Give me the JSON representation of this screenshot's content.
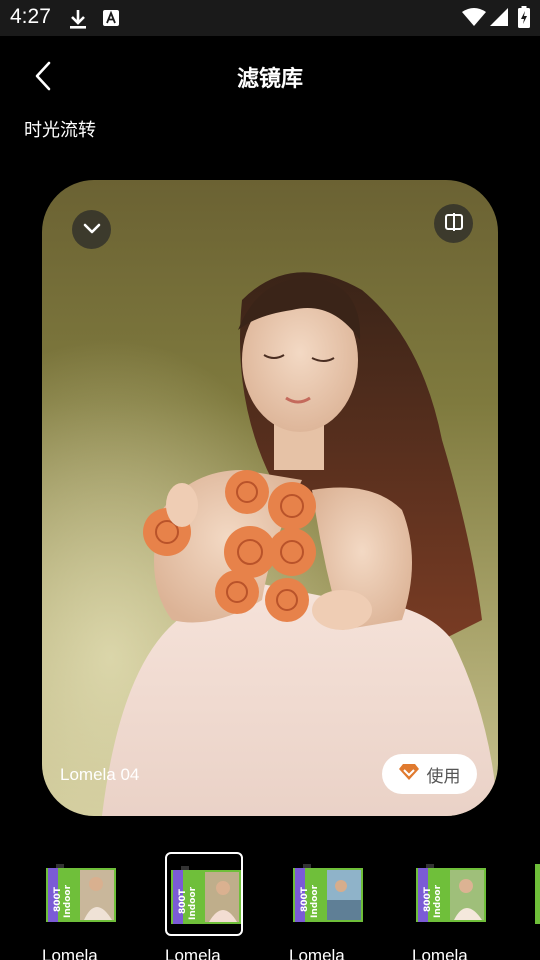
{
  "status_bar": {
    "time": "4:27",
    "icons": [
      "download-icon",
      "font-a-icon",
      "wifi-icon",
      "signal-icon",
      "battery-charging-icon"
    ]
  },
  "header": {
    "title": "滤镜库",
    "back_icon": "chevron-left-icon"
  },
  "section": {
    "label": "时光流转"
  },
  "preview": {
    "filter_name": "Lomela 04",
    "use_label": "使用",
    "collapse_icon": "chevron-down-icon",
    "compare_icon": "split-compare-icon",
    "use_icon": "diamond-vip-icon"
  },
  "filters": [
    {
      "label": "Lomela",
      "film_text": "800T Indoor",
      "selected": false
    },
    {
      "label": "Lomela",
      "film_text": "800T Indoor",
      "selected": true
    },
    {
      "label": "Lomela",
      "film_text": "800T Indoor",
      "selected": false
    },
    {
      "label": "Lomela",
      "film_text": "800T Indoor",
      "selected": false
    }
  ],
  "colors": {
    "background": "#000000",
    "status_bar": "#1a1a1a",
    "film_green": "#6fbf3a",
    "film_purple": "#7b5bd6",
    "diamond": "#e07a2f"
  }
}
